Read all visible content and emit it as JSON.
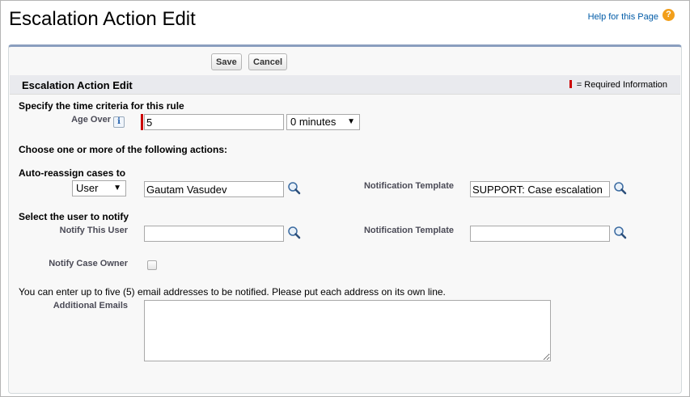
{
  "header": {
    "title": "Escalation Action Edit",
    "help_link": "Help for this Page",
    "help_icon": "help-icon"
  },
  "toolbar": {
    "save_label": "Save",
    "cancel_label": "Cancel"
  },
  "section": {
    "title": "Escalation Action Edit",
    "required_legend": "= Required Information"
  },
  "time_criteria": {
    "heading": "Specify the time criteria for this rule",
    "age_over_label": "Age Over",
    "age_over_value": "5",
    "age_unit_selected": "0 minutes"
  },
  "actions": {
    "heading": "Choose one or more of the following actions:"
  },
  "reassign": {
    "heading": "Auto-reassign cases to",
    "assignee_type_selected": "User",
    "assignee_value": "Gautam Vasudev",
    "notification_template_label": "Notification Template",
    "notification_template_value": "SUPPORT: Case escalation"
  },
  "notify": {
    "heading": "Select the user to notify",
    "notify_user_label": "Notify This User",
    "notify_user_value": "",
    "notification_template_label": "Notification Template",
    "notification_template_value": "",
    "notify_owner_label": "Notify Case Owner"
  },
  "emails": {
    "instructions": "You can enter up to five (5) email addresses to be notified. Please put each address on its own line.",
    "label": "Additional Emails",
    "value": ""
  },
  "colors": {
    "required": "#cc0000",
    "help_link": "#015ba7",
    "panel_border_top": "#8a9ebe"
  }
}
